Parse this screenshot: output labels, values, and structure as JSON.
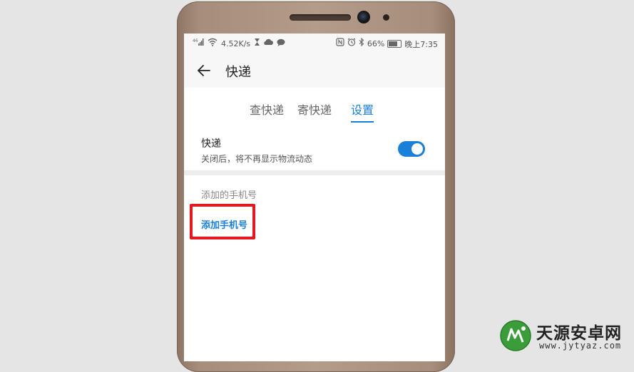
{
  "status_bar": {
    "signal_label": "⁴⁶",
    "network_speed": "4.52K/s",
    "battery_percent": "66%",
    "time": "晚上7:35",
    "left_icons": [
      "signal-icon",
      "wifi-icon",
      "hourglass-icon",
      "cloud-icon",
      "message-icon"
    ],
    "right_icons": [
      "nfc-icon",
      "alarm-icon",
      "bluetooth-icon",
      "battery-icon"
    ]
  },
  "app_bar": {
    "title": "快递"
  },
  "tabs": [
    {
      "label": "查快递",
      "active": false
    },
    {
      "label": "寄快递",
      "active": false
    },
    {
      "label": "设置",
      "active": true
    }
  ],
  "settings": {
    "express": {
      "title": "快递",
      "description": "关闭后，将不再显示物流动态",
      "enabled": true
    }
  },
  "phone_section": {
    "label": "添加的手机号",
    "add_link": "添加手机号"
  },
  "watermark": {
    "brand": "天源安卓网",
    "url": "www.jytyaz.com"
  },
  "colors": {
    "accent": "#1a7fd8",
    "highlight": "#e3191f",
    "phone_body": "#a78d7b"
  }
}
